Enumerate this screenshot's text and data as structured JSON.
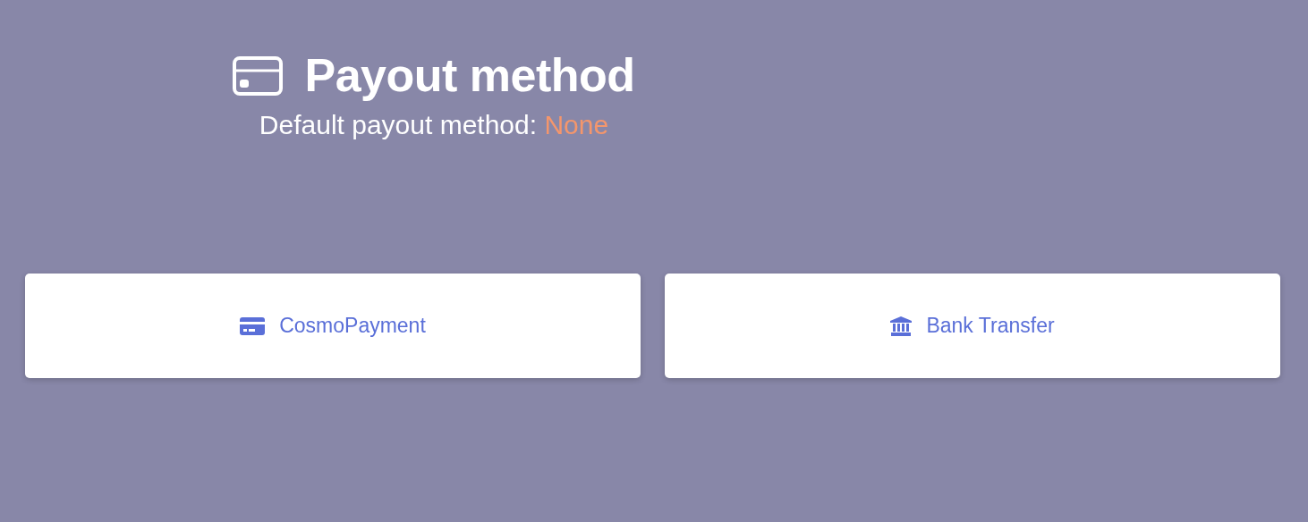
{
  "header": {
    "title": "Payout method",
    "subtitle_label": "Default payout method:",
    "subtitle_value": "None"
  },
  "methods": [
    {
      "kind": "card",
      "label": "CosmoPayment"
    },
    {
      "kind": "bank",
      "label": "Bank Transfer"
    }
  ]
}
